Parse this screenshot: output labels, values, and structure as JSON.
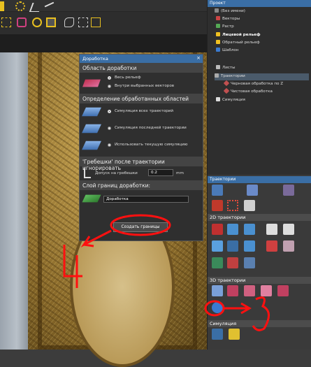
{
  "dialog": {
    "title": "Доработка",
    "close": "×",
    "section1": "Область доработки",
    "opt_all_relief": "Весь рельеф",
    "opt_inside_vectors": "Внутри выбранных векторов",
    "section2": "Определение обработанных областей",
    "opt_sim_all": "Симуляция всех траекторий",
    "opt_sim_last": "Симуляция последней траектории",
    "opt_sim_current": "Использовать текущую симуляцию",
    "section3": "'Гребешки' после траектории игнорировать",
    "tolerance_label": "Допуск на гребешки",
    "tolerance_value": "0.2",
    "tolerance_unit": "mm",
    "section4": "Слой границ доработки:",
    "layer_value": "Доработка",
    "create_button": "Создать границы"
  },
  "project": {
    "header": "Проект",
    "items": [
      "(Без имени)",
      "Векторы",
      "Растр",
      "Лицевой рельеф",
      "Обратный рельеф",
      "Шаблон",
      "Листы",
      "Траектории",
      "Черновая обработка по Z",
      "Чистовая обработка",
      "Симуляция"
    ]
  },
  "toolpaths": {
    "header": "Траектории",
    "section_2d": "2D траектории",
    "section_3d": "3D траектории",
    "section_sim": "Симуляция"
  },
  "annotations": {
    "label_4": "4",
    "label_3": "3"
  },
  "colors": {
    "accent": "#3a6ea5",
    "annotation": "#ff1010"
  }
}
